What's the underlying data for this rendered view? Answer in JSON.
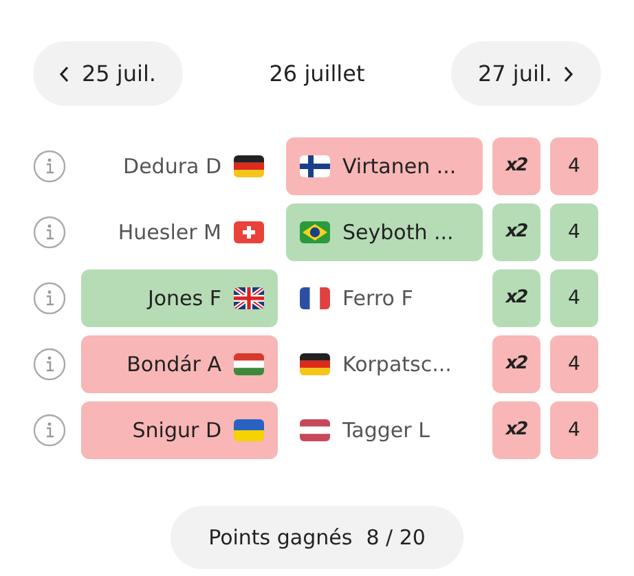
{
  "date_nav": {
    "previous": "25 juil.",
    "current": "26 juillet",
    "next": "27 juil."
  },
  "matches": [
    {
      "color": "#f8b6b6",
      "players": [
        {
          "name": "Dedura D",
          "kind": "de",
          "selected": false
        },
        {
          "name": "Virtanen ...",
          "kind": "fi",
          "selected": true
        }
      ],
      "multiplier": "x2",
      "points": "4"
    },
    {
      "color": "#b6dcb6",
      "players": [
        {
          "name": "Huesler M",
          "kind": "ch",
          "selected": false
        },
        {
          "name": "Seyboth ...",
          "kind": "br",
          "selected": true
        }
      ],
      "multiplier": "x2",
      "points": "4"
    },
    {
      "color": "#b6dcb6",
      "players": [
        {
          "name": "Jones F",
          "kind": "gb",
          "selected": true
        },
        {
          "name": "Ferro F",
          "kind": "fr",
          "selected": false
        }
      ],
      "multiplier": "x2",
      "points": "4"
    },
    {
      "color": "#f8b6b6",
      "players": [
        {
          "name": "Bondár A",
          "kind": "hu",
          "selected": true
        },
        {
          "name": "Korpatsc...",
          "kind": "de",
          "selected": false
        }
      ],
      "multiplier": "x2",
      "points": "4"
    },
    {
      "color": "#f8b6b6",
      "players": [
        {
          "name": "Snigur D",
          "kind": "ua",
          "selected": true
        },
        {
          "name": "Tagger L",
          "kind": "at",
          "selected": false
        }
      ],
      "multiplier": "x2",
      "points": "4"
    }
  ],
  "summary": {
    "label": "Points gagnés",
    "value": "8 / 20"
  }
}
